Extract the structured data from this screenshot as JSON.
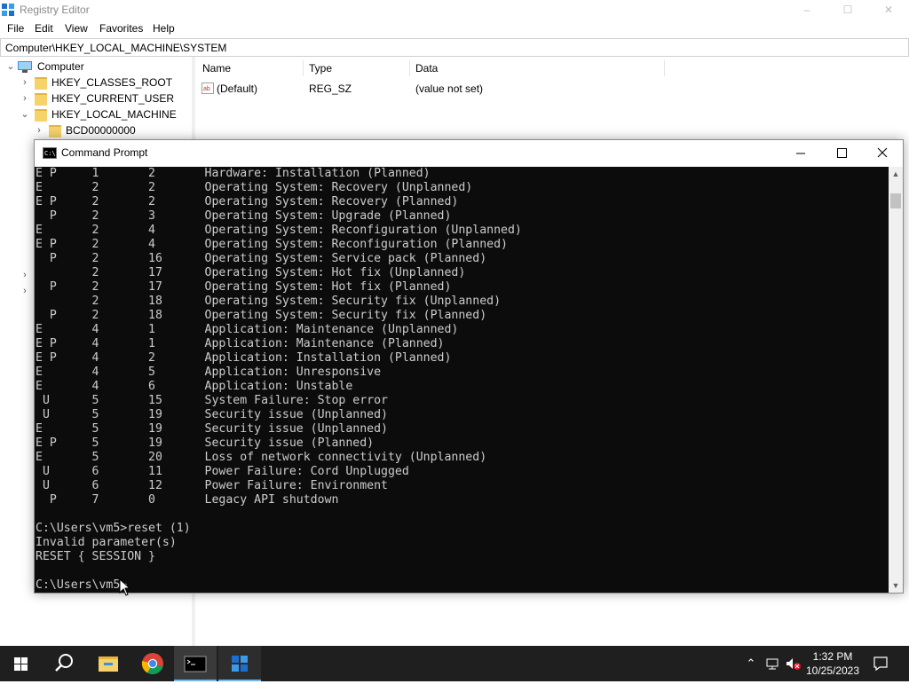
{
  "registry": {
    "title": "Registry Editor",
    "window_controls": [
      "–",
      "☐",
      "✕"
    ],
    "menu": [
      "File",
      "Edit",
      "View",
      "Favorites",
      "Help"
    ],
    "address": "Computer\\HKEY_LOCAL_MACHINE\\SYSTEM",
    "tree": {
      "root": "Computer",
      "items": [
        "HKEY_CLASSES_ROOT",
        "HKEY_CURRENT_USER",
        "HKEY_LOCAL_MACHINE",
        "BCD00000000"
      ]
    },
    "columns": {
      "name": "Name",
      "type": "Type",
      "data": "Data"
    },
    "values": [
      {
        "name": "(Default)",
        "type": "REG_SZ",
        "data": "(value not set)",
        "icon": "string-value-icon"
      }
    ]
  },
  "cmd": {
    "title": "Command Prompt",
    "icon_text": "C:\\",
    "lines": [
      "E P     1       2       Hardware: Installation (Planned)",
      "E       2       2       Operating System: Recovery (Unplanned)",
      "E P     2       2       Operating System: Recovery (Planned)",
      "  P     2       3       Operating System: Upgrade (Planned)",
      "E       2       4       Operating System: Reconfiguration (Unplanned)",
      "E P     2       4       Operating System: Reconfiguration (Planned)",
      "  P     2       16      Operating System: Service pack (Planned)",
      "        2       17      Operating System: Hot fix (Unplanned)",
      "  P     2       17      Operating System: Hot fix (Planned)",
      "        2       18      Operating System: Security fix (Unplanned)",
      "  P     2       18      Operating System: Security fix (Planned)",
      "E       4       1       Application: Maintenance (Unplanned)",
      "E P     4       1       Application: Maintenance (Planned)",
      "E P     4       2       Application: Installation (Planned)",
      "E       4       5       Application: Unresponsive",
      "E       4       6       Application: Unstable",
      " U      5       15      System Failure: Stop error",
      " U      5       19      Security issue (Unplanned)",
      "E       5       19      Security issue (Unplanned)",
      "E P     5       19      Security issue (Planned)",
      "E       5       20      Loss of network connectivity (Unplanned)",
      " U      6       11      Power Failure: Cord Unplugged",
      " U      6       12      Power Failure: Environment",
      "  P     7       0       Legacy API shutdown",
      "",
      "C:\\Users\\vm5>reset (1)",
      "Invalid parameter(s)",
      "RESET { SESSION }",
      "",
      "C:\\Users\\vm5>"
    ]
  },
  "taskbar": {
    "apps": [
      "start-icon",
      "search-icon",
      "file-explorer-icon",
      "chrome-icon",
      "command-prompt-icon",
      "registry-editor-icon"
    ],
    "time": "1:32 PM",
    "date": "10/25/2023"
  }
}
